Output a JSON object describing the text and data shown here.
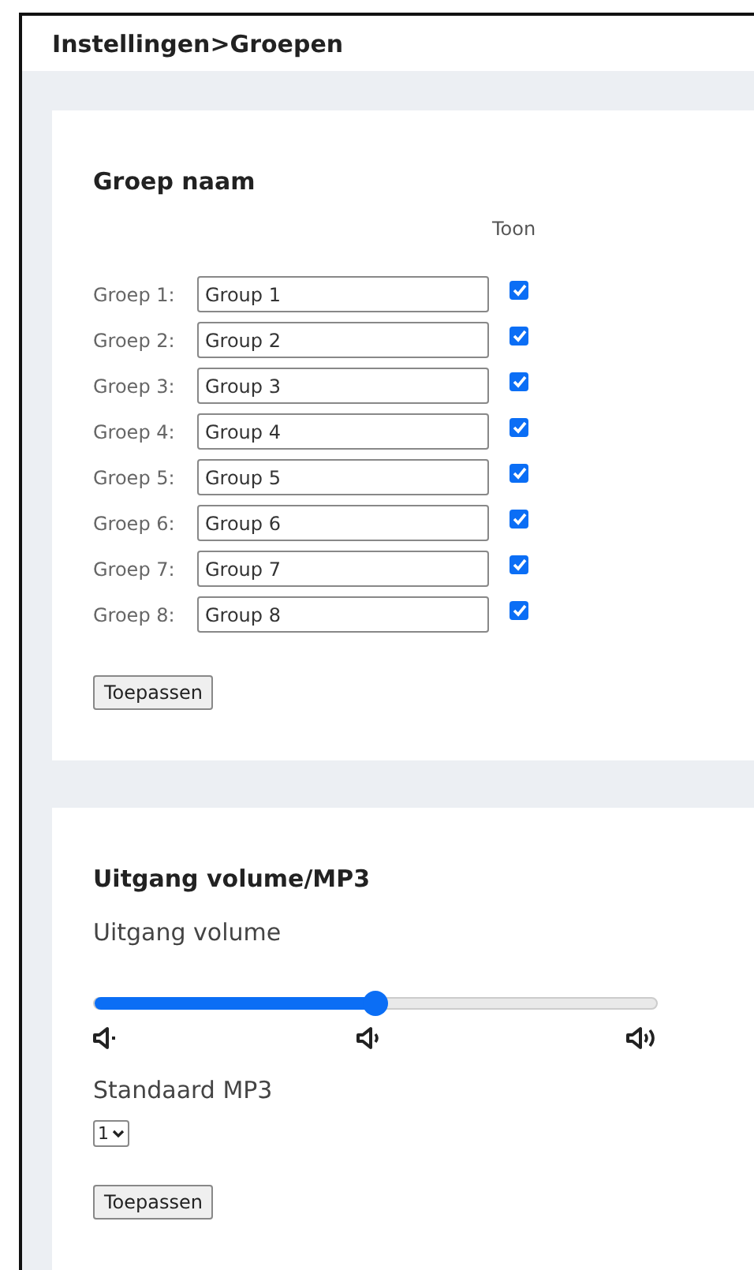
{
  "header": {
    "title": "Instellingen>Groepen"
  },
  "groups_card": {
    "title": "Groep naam",
    "show_heading": "Toon",
    "rows": [
      {
        "label": "Groep 1:",
        "value": "Group 1",
        "checked": true
      },
      {
        "label": "Groep 2:",
        "value": "Group 2",
        "checked": true
      },
      {
        "label": "Groep 3:",
        "value": "Group 3",
        "checked": true
      },
      {
        "label": "Groep 4:",
        "value": "Group 4",
        "checked": true
      },
      {
        "label": "Groep 5:",
        "value": "Group 5",
        "checked": true
      },
      {
        "label": "Groep 6:",
        "value": "Group 6",
        "checked": true
      },
      {
        "label": "Groep 7:",
        "value": "Group 7",
        "checked": true
      },
      {
        "label": "Groep 8:",
        "value": "Group 8",
        "checked": true
      }
    ],
    "apply_button": "Toepassen"
  },
  "volume_card": {
    "title": "Uitgang volume/MP3",
    "volume_label": "Uitgang volume",
    "volume": {
      "level": 0.5
    },
    "mp3_label": "Standaard MP3",
    "mp3_select": "1",
    "apply_button": "Toepassen"
  }
}
